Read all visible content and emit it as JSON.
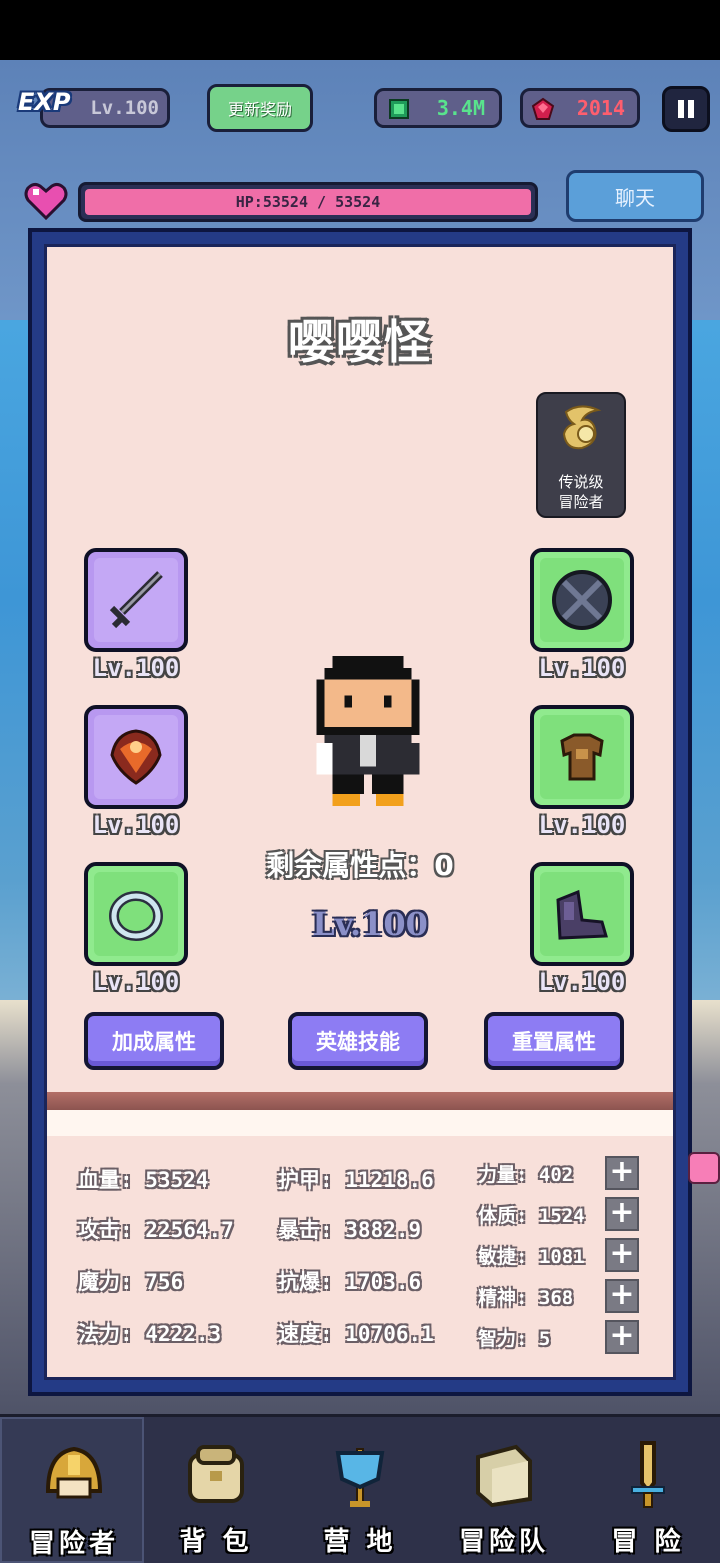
{
  "top_bar": {
    "exp_label": "EXP",
    "level": "Lv.100",
    "reward_button": "更新奖励",
    "gems": "3.4M",
    "rubies": "2014",
    "pause_icon": "pause-icon"
  },
  "hp": {
    "text": "HP:53524 / 53524",
    "current": 53524,
    "max": 53524,
    "color": "#f06ea8"
  },
  "chat_button": "聊天",
  "hero": {
    "name": "嘤嘤怪",
    "rank_badge": [
      "传说级",
      "冒险者"
    ],
    "remaining_points": "剩余属性点：0",
    "level": "Lv.100"
  },
  "equipment": {
    "left": [
      {
        "icon": "sword-icon",
        "level": "Lv.100",
        "rarity_color": "#b898f0"
      },
      {
        "icon": "amulet-icon",
        "level": "Lv.100",
        "rarity_color": "#b898f0"
      },
      {
        "icon": "ring-icon",
        "level": "Lv.100",
        "rarity_color": "#90ea8e"
      }
    ],
    "right": [
      {
        "icon": "shield-icon",
        "level": "Lv.100",
        "rarity_color": "#90ea8e"
      },
      {
        "icon": "armor-icon",
        "level": "Lv.100",
        "rarity_color": "#90ea8e"
      },
      {
        "icon": "boots-icon",
        "level": "Lv.100",
        "rarity_color": "#90ea8e"
      }
    ]
  },
  "actions": [
    "加成属性",
    "英雄技能",
    "重置属性"
  ],
  "stats": {
    "col1": [
      "血量: 53524",
      "攻击: 22564.7",
      "魔力: 756",
      "法力: 4222.3"
    ],
    "col2": [
      "护甲: 11218.6",
      "暴击: 3882.9",
      "抗爆: 1703.6",
      "速度: 10706.1"
    ],
    "attributes": [
      "力量: 402",
      "体质: 1524",
      "敏捷: 1081",
      "精神: 368",
      "智力: 5"
    ]
  },
  "bottom_nav": [
    {
      "label": "冒险者",
      "icon": "helmet-icon",
      "active": true
    },
    {
      "label": "背 包",
      "icon": "backpack-icon",
      "active": false
    },
    {
      "label": "营 地",
      "icon": "camp-banner-icon",
      "active": false
    },
    {
      "label": "冒险队",
      "icon": "book-icon",
      "active": false
    },
    {
      "label": "冒 险",
      "icon": "sword-nav-icon",
      "active": false
    }
  ]
}
